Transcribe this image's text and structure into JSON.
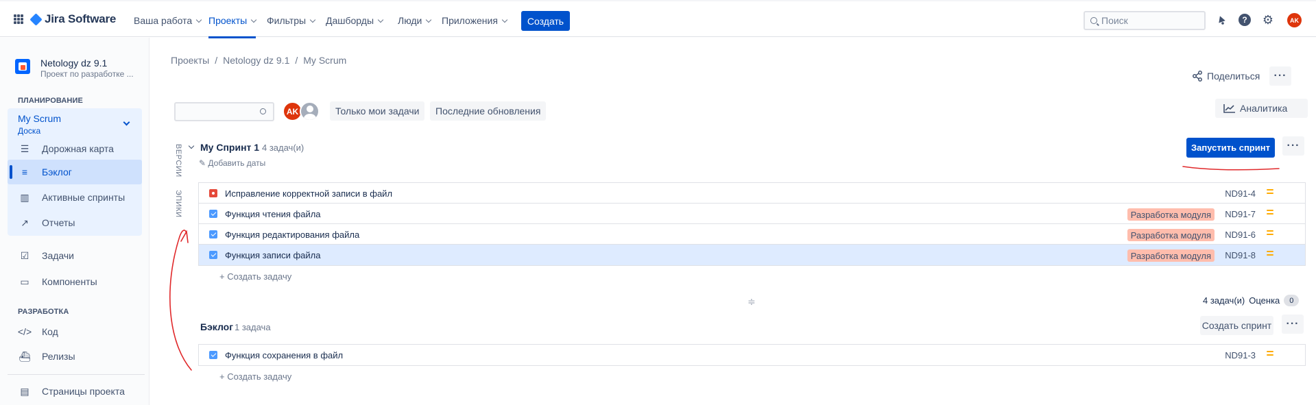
{
  "topnav": {
    "logo_text": "Jira Software",
    "items": [
      {
        "label": "Ваша работа"
      },
      {
        "label": "Проекты"
      },
      {
        "label": "Фильтры"
      },
      {
        "label": "Дашборды"
      },
      {
        "label": "Люди"
      },
      {
        "label": "Приложения"
      }
    ],
    "active_item": "Проекты",
    "create_label": "Создать",
    "search_placeholder": "Поиск",
    "user_initials": "AK",
    "icons": [
      "apps-grid-icon",
      "bell-icon",
      "help-icon",
      "settings-icon"
    ]
  },
  "sidebar": {
    "project_name": "Netology dz 9.1",
    "project_sub": "Проект по разработке ...",
    "planning_header": "ПЛАНИРОВАНИЕ",
    "board_name": "My Scrum",
    "board_sub": "Доска",
    "planning_items": [
      {
        "label": "Дорожная карта",
        "icon": "roadmap-icon"
      },
      {
        "label": "Бэклог",
        "icon": "backlog-icon",
        "active": true
      },
      {
        "label": "Активные спринты",
        "icon": "board-icon"
      },
      {
        "label": "Отчеты",
        "icon": "reports-icon"
      }
    ],
    "other_items": [
      {
        "label": "Задачи",
        "icon": "issues-icon"
      },
      {
        "label": "Компоненты",
        "icon": "components-icon"
      }
    ],
    "dev_header": "РАЗРАБОТКА",
    "dev_items": [
      {
        "label": "Код",
        "icon": "code-icon"
      },
      {
        "label": "Релизы",
        "icon": "releases-icon"
      }
    ],
    "pages_label": "Страницы проекта"
  },
  "main": {
    "breadcrumbs": [
      "Проекты",
      "Netology dz 9.1",
      "My Scrum"
    ],
    "share_label": "Поделиться",
    "filters": {
      "my_issues": "Только мои задачи",
      "recent_updates": "Последние обновления"
    },
    "avatar_initials": "AK",
    "analytics_label": "Аналитика",
    "vertical_tabs": {
      "versions": "ВЕРСИИ",
      "epics": "ЭПИКИ"
    },
    "sprint": {
      "title": "My Спринт 1",
      "count": "4 задач(и)",
      "add_dates": "Добавить даты",
      "start_label": "Запустить спринт",
      "issues": [
        {
          "type": "bug",
          "summary": "Исправление корректной записи в файл",
          "epic": "",
          "key": "ND91-4",
          "priority": "medium"
        },
        {
          "type": "story",
          "summary": "Функция чтения файла",
          "epic": "Разработка модуля",
          "key": "ND91-7",
          "priority": "medium"
        },
        {
          "type": "story",
          "summary": "Функция редактирования файла",
          "epic": "Разработка модуля",
          "key": "ND91-6",
          "priority": "medium"
        },
        {
          "type": "story",
          "summary": "Функция записи файла",
          "epic": "Разработка модуля",
          "key": "ND91-8",
          "priority": "medium",
          "selected": true
        }
      ],
      "create_issue": "+   Создать задачу",
      "footer_count": "4 задач(и)",
      "footer_estimate_label": "Оценка",
      "footer_estimate_value": "0"
    },
    "backlog": {
      "title": "Бэклог",
      "count": "1 задача",
      "create_sprint": "Создать спринт",
      "issues": [
        {
          "type": "story",
          "summary": "Функция сохранения в файл",
          "key": "ND91-3",
          "priority": "medium"
        }
      ],
      "create_issue": "+   Создать задачу"
    }
  },
  "colors": {
    "brand": "#0052cc",
    "epic_lozenge": "#ffbdad",
    "priority": "#ffab00",
    "annotation": "#e0282a"
  }
}
